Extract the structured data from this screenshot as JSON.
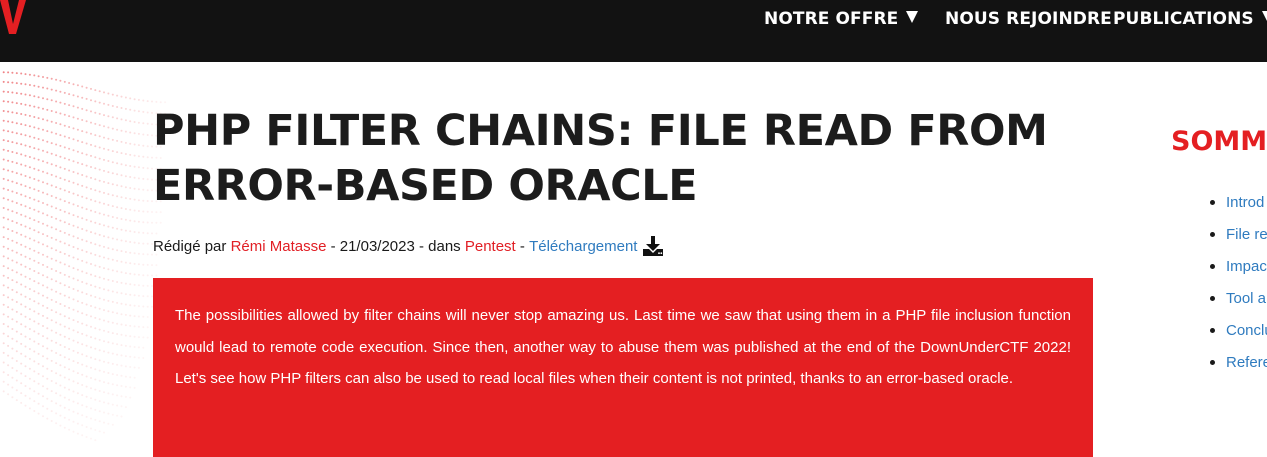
{
  "nav": {
    "items": [
      {
        "label": "NOTRE OFFRE",
        "has_dropdown": true
      },
      {
        "label": "NOUS REJOINDRE",
        "has_dropdown": false
      },
      {
        "label": "PUBLICATIONS",
        "has_dropdown": true
      }
    ]
  },
  "article": {
    "title": "PHP FILTER CHAINS: FILE READ FROM ERROR-BASED ORACLE",
    "meta": {
      "written_by": "Rédigé par",
      "author": "Rémi Matasse",
      "date_sep": " - 21/03/2023 - dans ",
      "category": "Pentest",
      "dash": " - ",
      "download": "Téléchargement",
      "download_icon": "download-icon"
    },
    "intro": "The possibilities allowed by filter chains will never stop amazing us. Last time we saw that using them in a PHP file inclusion function would lead to remote code execution. Since then, another way to abuse them was published at the end of the DownUnderCTF 2022! Let's see how PHP filters can also be used to read local files when their content is not printed, thanks to an error-based oracle."
  },
  "toc": {
    "title": "SOMMA",
    "items": [
      "Introd",
      "File re",
      "Impac",
      "Tool a",
      "Conclu",
      "Refere"
    ]
  },
  "colors": {
    "accent_red": "#e41f22",
    "link_blue": "#2f7bbf",
    "topbar": "#121212"
  }
}
